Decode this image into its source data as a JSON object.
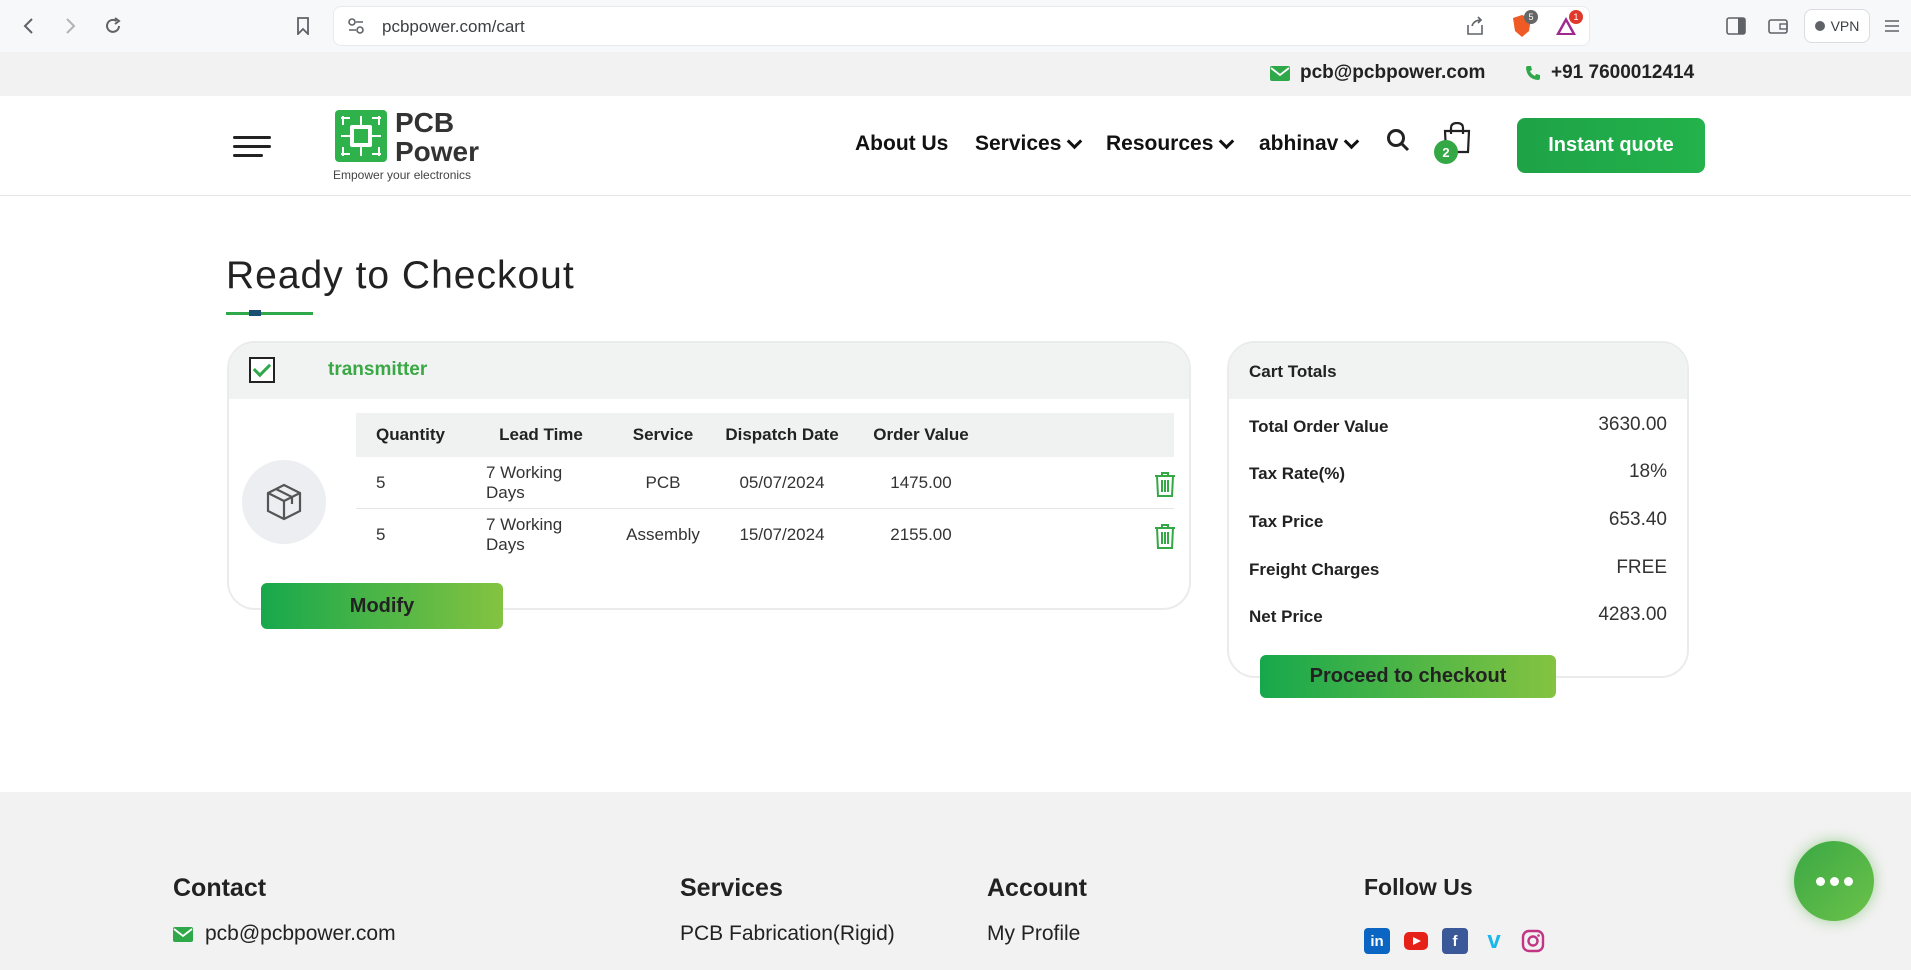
{
  "browser": {
    "url": "pcbpower.com/cart",
    "vpn_label": "VPN",
    "brave_badge": "5",
    "alert_badge": "1"
  },
  "contact_bar": {
    "email": "pcb@pcbpower.com",
    "phone": "+91 7600012414"
  },
  "header": {
    "logo_line1": "PCB",
    "logo_line2": "Power",
    "logo_tagline": "Empower your electronics",
    "menu": [
      "About Us",
      "Services",
      "Resources",
      "abhinav"
    ],
    "cart_count": "2",
    "instant_quote": "Instant quote"
  },
  "page": {
    "title": "Ready to Checkout"
  },
  "product": {
    "name": "transmitter",
    "columns": [
      "Quantity",
      "Lead Time",
      "Service",
      "Dispatch Date",
      "Order Value"
    ],
    "rows": [
      {
        "quantity": "5",
        "lead_time": "7 Working Days",
        "service": "PCB",
        "dispatch_date": "05/07/2024",
        "order_value": "1475.00"
      },
      {
        "quantity": "5",
        "lead_time": "7 Working Days",
        "service": "Assembly",
        "dispatch_date": "15/07/2024",
        "order_value": "2155.00"
      }
    ],
    "modify_label": "Modify"
  },
  "totals": {
    "title": "Cart Totals",
    "rows": [
      {
        "label": "Total Order Value",
        "value": "3630.00"
      },
      {
        "label": "Tax Rate(%)",
        "value": "18%"
      },
      {
        "label": "Tax Price",
        "value": "653.40"
      },
      {
        "label": "Freight Charges",
        "value": "FREE"
      },
      {
        "label": "Net Price",
        "value": "4283.00"
      }
    ],
    "checkout_label": "Proceed to checkout"
  },
  "footer": {
    "contact_title": "Contact",
    "contact_email": "pcb@pcbpower.com",
    "services_title": "Services",
    "services_item": "PCB Fabrication(Rigid)",
    "account_title": "Account",
    "account_item": "My Profile",
    "follow_title": "Follow Us",
    "social": [
      "linkedin-icon",
      "youtube-icon",
      "facebook-icon",
      "vimeo-icon",
      "instagram-icon"
    ]
  },
  "colors": {
    "brand_green": "#23b24b",
    "accent_lime": "#84c341",
    "product_name": "#3aa844"
  }
}
